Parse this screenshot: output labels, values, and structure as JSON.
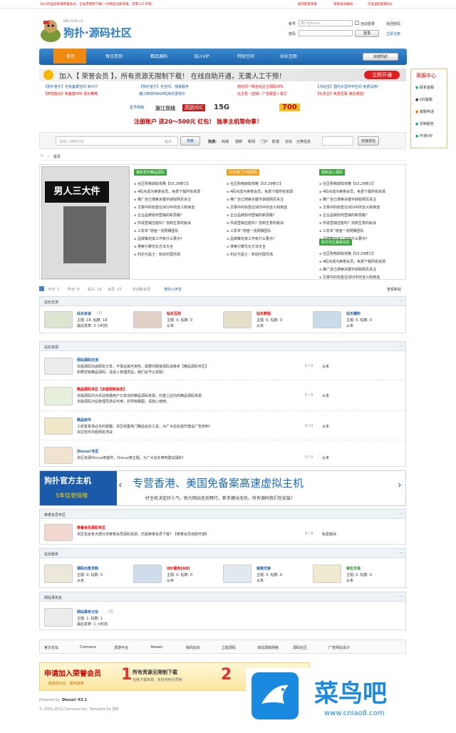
{
  "topbar": {
    "left": "24小时自助开通荣誉会员，全站无限制下载！(付款后立即开通，无需人工干预)",
    "links": [
      "如何获取荣誉",
      "荣誉会员群组",
      "点击发起客服QQ"
    ]
  },
  "logo": {
    "name": "狗扑·源码社区",
    "url": "BBS.GOPE.CN"
  },
  "login": {
    "account_label": "帐号",
    "account_placeholder": "用户名/Email",
    "remember": "自动登录",
    "password_label": "密码",
    "login_btn": "登录",
    "register": "立即注册",
    "find_pw": "找回密码"
  },
  "nav": {
    "items": [
      "首页",
      "每日签到",
      "精品源码",
      "加入VIP",
      "特权空间",
      "站长互助"
    ],
    "quick": "快捷导航"
  },
  "banner": {
    "text": "加入【 荣誉会员 】，所有资源无限制下载！ 在线自助开通，无需人工干预！",
    "btn": "立即开通"
  },
  "promo_links": [
    "【狗扑官方】无免备案空间 就¥37",
    "【狗扑官方】无空间，独家服务",
    "抢时间一网全站正立源码VPS",
    "【点站宝】国内大型PHP空间 免费试用！",
    "【高性能云】免备案VPS 低价推荐",
    "播江西郑州BGP机房优惠低价",
    "云主机（送钱）广告联盟 / 其它",
    "【北京五】免费互联 我在赠送！"
  ],
  "ad_small": {
    "brand": "壹予网络",
    "t1": "浙江双线",
    "t2": "高防IDC",
    "t3": "15G",
    "t4": "700",
    "bottom": "注册账户 送20～500元 红包！ 独享主机等你拿！"
  },
  "search": {
    "placeholder": "请输入搜索内容",
    "type": "帖子",
    "btn": "搜索",
    "hot_label": "热搜:",
    "hot": [
      "商城",
      "视频",
      "新闻",
      "门户",
      "影视",
      "论坛",
      "分类信息"
    ],
    "btn2": "快速发帖"
  },
  "breadcrumb": {
    "home": "首页"
  },
  "sidebar": {
    "title": "客服中心",
    "items": [
      "联系客服",
      "QQ客服",
      "客服电话",
      "定制服务",
      "开通VIP"
    ]
  },
  "hot": {
    "col1_title": "最新发布精品源码",
    "col2_title": "本月热门下载源码",
    "col3_title": "最新加入源码",
    "col4_title": "购付社区最新动态",
    "items": [
      "社区购物获取攻略【03.29修订】",
      "4码点成为荣誉会员，免费下载所有资源",
      "推广自己搜索关键字获取网页关注",
      "文章中的标签在SEO中的含义和用途",
      "企业品牌如何营销的新思路？",
      "你说营销还能吗？找到生意的秘诀",
      "三折年”增值一流网赚团队",
      "品牌策划该工作有什么要点？",
      "搜索引擎优化方法大全",
      "利达与盈士：积动中国市场"
    ],
    "image_caption": "男人三大件"
  },
  "stats": {
    "today": "今日: 2",
    "yesterday": "昨日: 8",
    "posts": "帖子: 19",
    "members": "会员: 37",
    "newest": "欢迎新会员: ",
    "newmember": "搜外小天空",
    "right": "查看新帖"
  },
  "sec1": {
    "title": "站长交流",
    "boards": [
      {
        "name": "站长杂谈",
        "count": "(1)",
        "stats": "主题: 18, 帖数: 18",
        "last": "最后发表: 3 小时前"
      },
      {
        "name": "站长互助",
        "stats": "主题: 0, 帖数: 0",
        "last": "从未"
      },
      {
        "name": "站长教程",
        "stats": "主题: 0, 帖数: 0",
        "last": "从未"
      },
      {
        "name": "站长爆料",
        "stats": "主题: 0, 帖数: 0",
        "last": "从未"
      }
    ]
  },
  "sec2": {
    "title": "站长资源",
    "rows": [
      {
        "name": "网站源码交流",
        "desc": "本版源码均由网友分享，不保证其可用性，需要问题使源码请移步【精品源码专区】",
        "desc2": "如果您有精品源码，请进入管理员后，我们会予以奖励！",
        "nums": "0 / 0",
        "last": "从未"
      },
      {
        "name": "精品源码专区【本版限制会员】",
        "desc": "本版源码均为本站特邀用户分享出的精品源码资源，仍建上后均的精品源码资源",
        "desc2": "本版源码为站管理员测试可用，并附有截图，请放心使用。",
        "nums": "0 / 0",
        "last": "从未"
      },
      {
        "name": "精品软件",
        "desc": "工欲善其事必先利其器，本区收集热门精品站长工具，为广大站长提升建设广告到到！",
        "desc2": "本区软件均经网友测试",
        "nums": "0 / 0",
        "last": "从未"
      },
      {
        "name": "Discuz!专区",
        "desc": "本区资源Discuz用插件，Discuz用主题，为广大站长带到建站福利！",
        "nums": "0 / 0",
        "last": "从未"
      }
    ]
  },
  "banner2": {
    "left1": "狗扑官方主机",
    "left2": "5年信誉保障",
    "main": "专营香港、美国免备案高速虚拟主机",
    "sub": "好主机决定好人气，助力网站无忧畅行。新手建站无忧，所有源码我们包安装！"
  },
  "sec3": {
    "title": "荣誉会员专区",
    "row": {
      "name": "荣誉会员源码专区",
      "desc": "本区包含有大部分非荣誉会员源码资源，仍需荣誉会员下载？【荣誉会员自助开通】",
      "nums": "0 / 0",
      "last": "私密版块"
    }
  },
  "sec4": {
    "title": "站长服务",
    "boards": [
      {
        "name": "源码出售求购",
        "stats": "主题: 0, 帖数: 0",
        "last": "从未"
      },
      {
        "name": "IDC服务[AD]",
        "stats": "主题: 0, 帖数: 0",
        "last": "从未"
      },
      {
        "name": "链接交换",
        "stats": "主题: 0, 帖数: 0",
        "last": "从未"
      },
      {
        "name": "域名交易",
        "stats": "主题: 0, 帖数: 0",
        "last": "从未"
      }
    ]
  },
  "sec5": {
    "title": "网站事务处",
    "board": {
      "name": "网站事务讨论",
      "count": "(2)",
      "stats": "主题: 1, 帖数: 1",
      "last": "最后发表: 1 小时前"
    }
  },
  "links": {
    "label": "官方论坛",
    "items": [
      "Comsenz",
      "漫游平台",
      "Yeesan",
      "我的站长",
      "立能源码",
      "单站源库网络",
      "源码社区",
      "广告网站设计"
    ]
  },
  "bottom_ad": {
    "t1": "申请加入荣誉会员",
    "t2": "超高性价比 · 超快速率",
    "n1": "1",
    "b1": "所有资源无限制下载",
    "s1": "任我下载资源 · 无任何积分限制",
    "n2": "2"
  },
  "footer": {
    "powered": "Powered by ",
    "discuz": "Discuz! X3.1",
    "copy": "© 2001-2013 Comsenz Inc. Template by 狗扑"
  },
  "watermark": {
    "name": "菜鸟吧",
    "url": "www.cniao8.com"
  }
}
